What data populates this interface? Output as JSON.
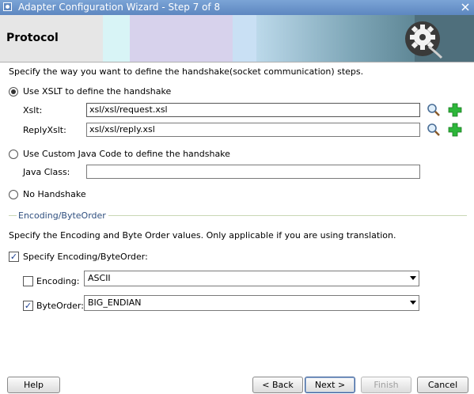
{
  "window": {
    "title": "Adapter Configuration Wizard - Step 7 of 8"
  },
  "header": {
    "title": "Protocol"
  },
  "instruction": "Specify the way you want to define the handshake(socket communication) steps.",
  "handshake": {
    "xslt_option": "Use XSLT to define the handshake",
    "xsl_label": "Xslt:",
    "xsl_value": "xsl/xsl/request.xsl",
    "reply_label": "ReplyXslt:",
    "reply_value": "xsl/xsl/reply.xsl",
    "java_option": "Use Custom Java Code to define the handshake",
    "java_label": "Java Class:",
    "java_value": "",
    "none_option": "No Handshake"
  },
  "encoding_section": {
    "title": "Encoding/ByteOrder",
    "description": "Specify the Encoding and Byte Order values. Only applicable if you are using translation.",
    "specify_label": "Specify Encoding/ByteOrder:",
    "encoding_label": "Encoding:",
    "encoding_value": "ASCII",
    "byteorder_label": "ByteOrder:",
    "byteorder_value": "BIG_ENDIAN"
  },
  "buttons": {
    "help": "Help",
    "back": "< Back",
    "next": "Next >",
    "finish": "Finish",
    "cancel": "Cancel"
  },
  "icons": {
    "search": "magnifier-icon",
    "add": "green-plus-icon",
    "banner": "gear-plug-icon"
  }
}
